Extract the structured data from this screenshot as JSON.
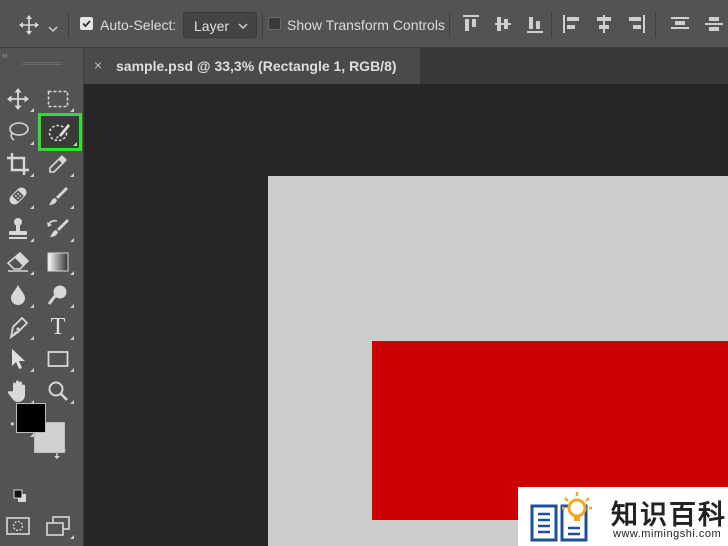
{
  "options_bar": {
    "auto_select_label": "Auto-Select:",
    "auto_select_checked": true,
    "auto_select_target": "Layer",
    "transform_label": "Show Transform Controls",
    "transform_checked": false
  },
  "document_tab": {
    "title": "sample.psd @ 33,3% (Rectangle 1, RGB/8)",
    "close_glyph": "×"
  },
  "panel": {
    "collapse_glyph": "‹‹"
  },
  "tools": [
    {
      "name": "move-tool",
      "icon": "move-icon"
    },
    {
      "name": "rectangular-marquee-tool",
      "icon": "marquee-icon"
    },
    {
      "name": "lasso-tool",
      "icon": "lasso-icon"
    },
    {
      "name": "quick-selection-tool",
      "icon": "quick-selection-icon",
      "selected": true
    },
    {
      "name": "crop-tool",
      "icon": "crop-icon"
    },
    {
      "name": "eyedropper-tool",
      "icon": "eyedropper-icon"
    },
    {
      "name": "healing-brush-tool",
      "icon": "bandage-icon"
    },
    {
      "name": "brush-tool",
      "icon": "brush-icon"
    },
    {
      "name": "clone-stamp-tool",
      "icon": "stamp-icon"
    },
    {
      "name": "history-brush-tool",
      "icon": "history-brush-icon"
    },
    {
      "name": "eraser-tool",
      "icon": "eraser-icon"
    },
    {
      "name": "gradient-tool",
      "icon": "gradient-icon"
    },
    {
      "name": "blur-tool",
      "icon": "drop-icon"
    },
    {
      "name": "dodge-tool",
      "icon": "dodge-icon"
    },
    {
      "name": "pen-tool",
      "icon": "pen-icon"
    },
    {
      "name": "type-tool",
      "icon": "type-icon",
      "label": "T"
    },
    {
      "name": "path-selection-tool",
      "icon": "arrow-icon"
    },
    {
      "name": "rectangle-tool",
      "icon": "rectangle-icon"
    },
    {
      "name": "hand-tool",
      "icon": "hand-icon"
    },
    {
      "name": "zoom-tool",
      "icon": "zoom-icon"
    },
    {
      "name": "edit-toolbar",
      "icon": "ellipsis-icon",
      "label": "•••"
    }
  ],
  "colors": {
    "foreground": "#000000",
    "background": "#d0d0d0",
    "document_fill": "#cccccc",
    "rectangle_fill": "#cc0000",
    "selected_outline": "#2fe02f"
  },
  "watermark": {
    "title": "知识百科",
    "url": "www.mimingshi.com"
  }
}
